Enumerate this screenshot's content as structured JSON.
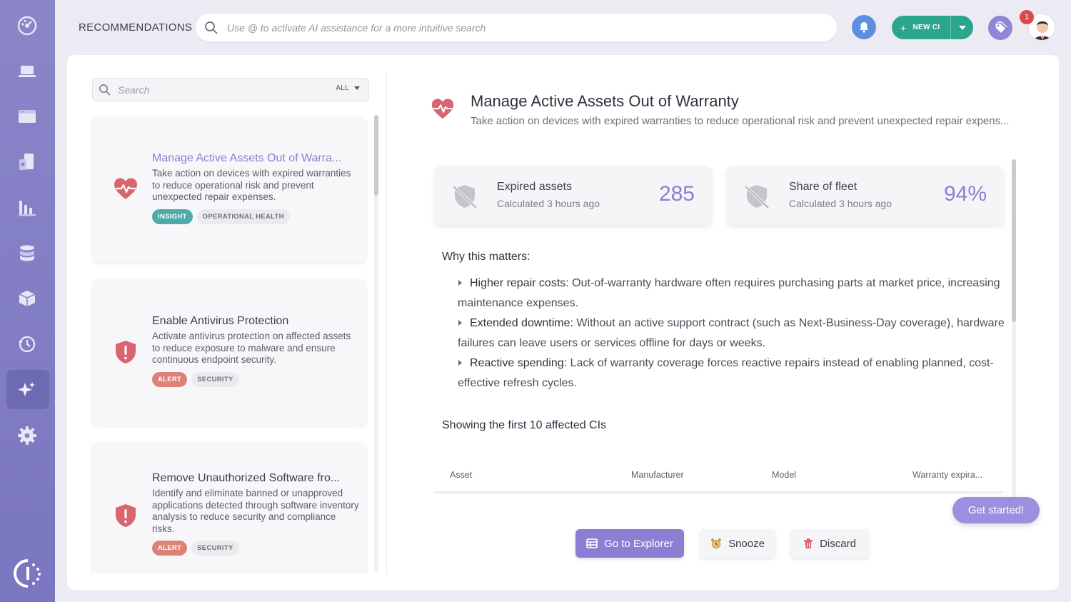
{
  "header": {
    "title": "RECOMMENDATIONS",
    "search_placeholder": "Use @ to activate AI assistance for a more intuitive search",
    "new_ci_label": "NEW CI",
    "notification_count": "1"
  },
  "sidebar": {
    "items": [
      {
        "icon": "dashboard-icon"
      },
      {
        "icon": "laptop-icon"
      },
      {
        "icon": "browser-window-icon"
      },
      {
        "icon": "devices-icon"
      },
      {
        "icon": "bar-chart-icon"
      },
      {
        "icon": "database-icon"
      },
      {
        "icon": "package-icon"
      },
      {
        "icon": "history-icon"
      },
      {
        "icon": "sparkle-ai-icon",
        "active": true
      },
      {
        "icon": "gear-icon"
      }
    ]
  },
  "list": {
    "search_placeholder": "Search",
    "filter_value": "ALL",
    "cards": [
      {
        "title": "Manage Active Assets Out of Warra...",
        "description": "Take action on devices with expired warranties to reduce operational risk and prevent unexpected repair expenses.",
        "chip1": "INSIGHT",
        "chip2": "OPERATIONAL HEALTH",
        "icon": "heart-pulse-icon"
      },
      {
        "title": "Enable Antivirus Protection",
        "description": "Activate antivirus protection on affected assets to reduce exposure to malware and ensure continuous endpoint security.",
        "chip1": "ALERT",
        "chip2": "SECURITY",
        "icon": "shield-alert-icon"
      },
      {
        "title": "Remove Unauthorized Software fro...",
        "description": "Identify and eliminate banned or unapproved applications detected through software inventory analysis to reduce security and compliance risks.",
        "chip1": "ALERT",
        "chip2": "SECURITY",
        "icon": "shield-alert-icon"
      }
    ]
  },
  "detail": {
    "title": "Manage Active Assets Out of Warranty",
    "subtitle": "Take action on devices with expired warranties to reduce operational risk and prevent unexpected repair expens...",
    "stats": [
      {
        "label": "Expired assets",
        "sub": "Calculated 3 hours ago",
        "value": "285"
      },
      {
        "label": "Share of fleet",
        "sub": "Calculated 3 hours ago",
        "value": "94%"
      }
    ],
    "why_title": "Why this matters:",
    "reasons": [
      {
        "head": "Higher repair costs:",
        "body": " Out-of-warranty hardware often requires purchasing parts at market price, increasing maintenance expenses."
      },
      {
        "head": "Extended downtime:",
        "body": " Without an active support contract (such as Next-Business-Day coverage), hardware failures can leave users or services offline for days or weeks."
      },
      {
        "head": "Reactive spending:",
        "body": " Lack of warranty coverage forces reactive repairs instead of enabling planned, cost-effective refresh cycles."
      }
    ],
    "showing": "Showing the first 10 affected CIs",
    "columns": [
      "Asset",
      "Manufacturer",
      "Model",
      "Warranty expira..."
    ],
    "buttons": {
      "explorer": "Go to Explorer",
      "snooze": "Snooze",
      "discard": "Discard"
    }
  },
  "get_started": "Get started!",
  "colors": {
    "accent": "#8b7fd4",
    "sidebar": "#8b86c9",
    "insight": "#4caaa8",
    "alert": "#dc8277",
    "new_ci": "#2aa68c"
  }
}
